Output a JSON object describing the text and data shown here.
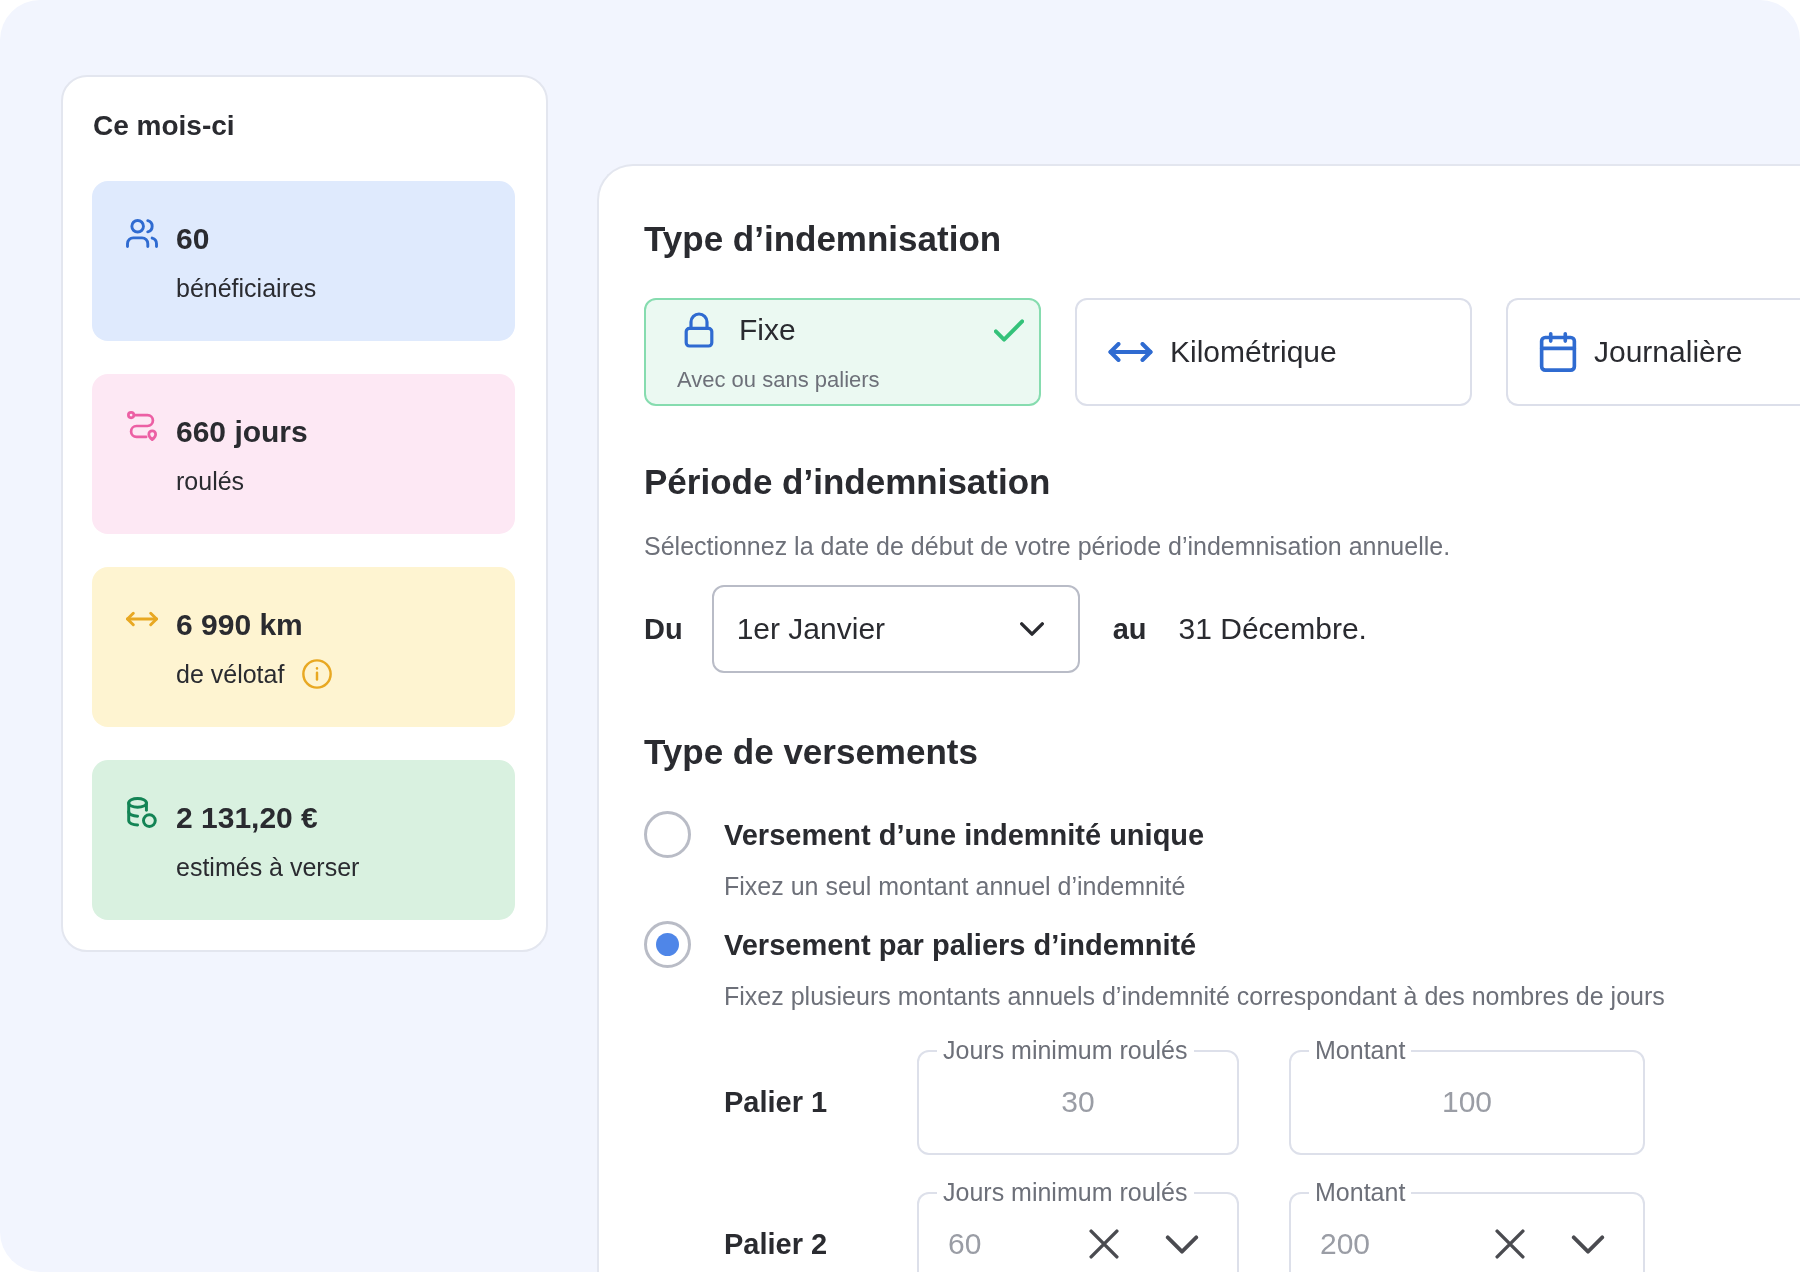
{
  "summary": {
    "title": "Ce mois-ci",
    "stats": [
      {
        "kind": "users",
        "value": "60",
        "label": "bénéficiaires",
        "color": "#dfeafd",
        "info": false
      },
      {
        "kind": "route",
        "value": "660 jours",
        "label": "roulés",
        "color": "#fde8f4",
        "info": false
      },
      {
        "kind": "distance",
        "value": "6 990 km",
        "label": "de vélotaf",
        "color": "#fef4d1",
        "info": true
      },
      {
        "kind": "money",
        "value": "2 131,20 €",
        "label": "estimés à verser",
        "color": "#d9f1e0",
        "info": false
      }
    ]
  },
  "compensation": {
    "title": "Type d’indemnisation",
    "types": [
      {
        "kind": "fixed",
        "label": "Fixe",
        "hint": "Avec ou sans paliers",
        "selected": true
      },
      {
        "kind": "distance",
        "label": "Kilométrique",
        "selected": false
      },
      {
        "kind": "daily",
        "label": "Journalière",
        "selected": false
      }
    ]
  },
  "period": {
    "title": "Période d’indemnisation",
    "description": "Sélectionnez la date de début de votre période d’indemnisation annuelle.",
    "from_label": "Du",
    "start_select": {
      "value": "1er Janvier"
    },
    "to_label": "au",
    "end_date": "31 Décembre."
  },
  "payments": {
    "title": "Type de versements",
    "options": [
      {
        "label": "Versement d’une indemnité unique",
        "description": "Fixez un seul montant annuel d’indemnité",
        "selected": false
      },
      {
        "label": "Versement par paliers d’indemnité",
        "description": "Fixez plusieurs montants annuels d’indemnité correspondant à des nombres de jours",
        "selected": true
      }
    ],
    "tiers": [
      {
        "label": "Palier 1",
        "fields": [
          {
            "kind": "plain",
            "label": "Jours minimum roulés",
            "value": "30"
          },
          {
            "kind": "plain",
            "label": "Montant",
            "value": "100"
          }
        ]
      },
      {
        "label": "Palier 2",
        "fields": [
          {
            "kind": "clearable",
            "label": "Jours minimum roulés",
            "value": "60"
          },
          {
            "kind": "clearable",
            "label": "Montant",
            "value": "200"
          }
        ]
      }
    ]
  }
}
